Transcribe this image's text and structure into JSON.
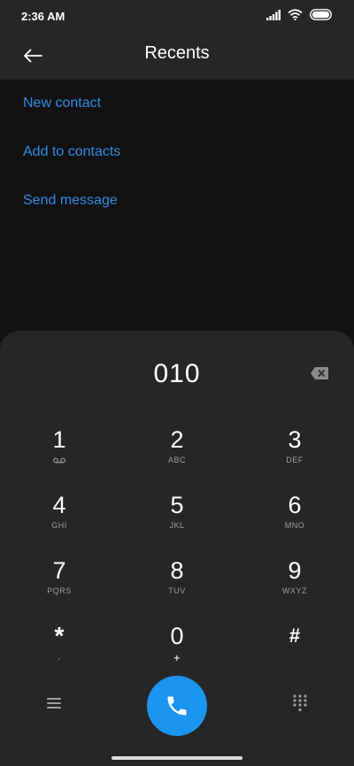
{
  "status_bar": {
    "time": "2:36 AM"
  },
  "header": {
    "title": "Recents"
  },
  "actions": [
    {
      "label": "New contact"
    },
    {
      "label": "Add to contacts"
    },
    {
      "label": "Send message"
    }
  ],
  "dialer": {
    "number": "010",
    "keys": [
      {
        "digit": "1",
        "letters": ""
      },
      {
        "digit": "2",
        "letters": "ABC"
      },
      {
        "digit": "3",
        "letters": "DEF"
      },
      {
        "digit": "4",
        "letters": "GHI"
      },
      {
        "digit": "5",
        "letters": "JKL"
      },
      {
        "digit": "6",
        "letters": "MNO"
      },
      {
        "digit": "7",
        "letters": "PQRS"
      },
      {
        "digit": "8",
        "letters": "TUV"
      },
      {
        "digit": "9",
        "letters": "WXYZ"
      },
      {
        "digit": "*",
        "letters": ","
      },
      {
        "digit": "0",
        "letters": "+"
      },
      {
        "digit": "#",
        "letters": ""
      }
    ]
  },
  "colors": {
    "accent": "#2f8de4",
    "call_button": "#1a95f0",
    "panel": "#262626",
    "background": "#121212"
  },
  "icons": {
    "back": "arrow-left-icon",
    "backspace": "backspace-icon",
    "voicemail": "voicemail-icon",
    "call": "phone-icon",
    "menu": "menu-icon",
    "dialpad": "dialpad-icon"
  }
}
